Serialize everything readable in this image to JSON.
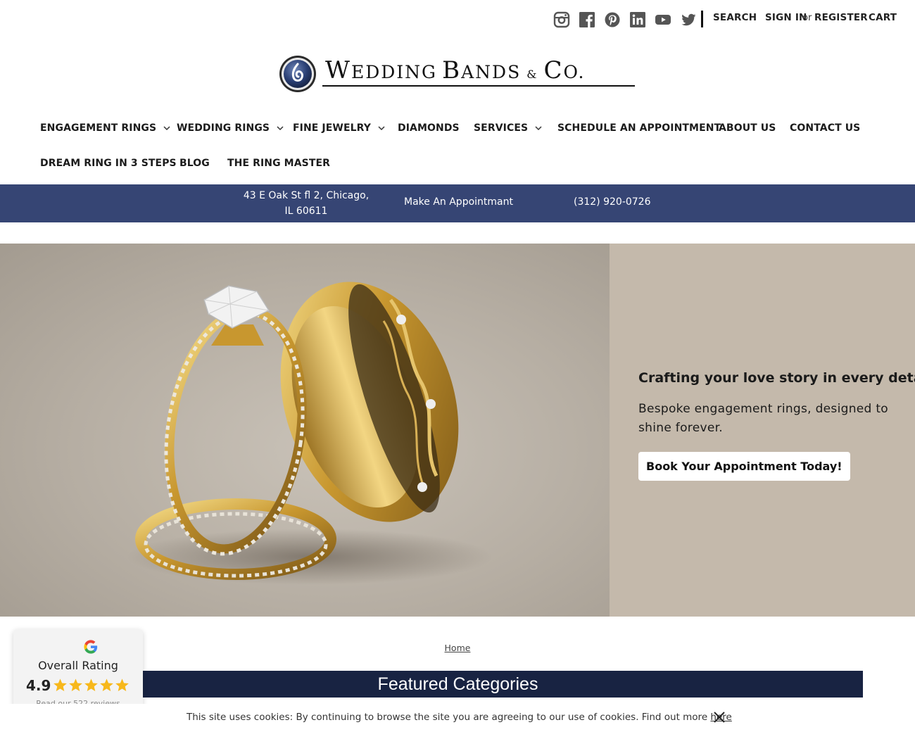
{
  "topbar": {
    "social_icons": [
      "instagram-icon",
      "facebook-icon",
      "pinterest-icon",
      "linkedin-icon",
      "youtube-icon",
      "twitter-icon"
    ],
    "search_label": "SEARCH",
    "signin_label": "SIGN IN",
    "or_label": "or",
    "register_label": "REGISTER",
    "cart_label": "CART"
  },
  "logo": {
    "w": "W",
    "edding": "EDDING",
    "b": "B",
    "ands": "ANDS",
    "amp": "&",
    "c": "C",
    "o": "O."
  },
  "nav": {
    "items": [
      {
        "label": "ENGAGEMENT RINGS",
        "has_dropdown": true
      },
      {
        "label": "WEDDING RINGS",
        "has_dropdown": true
      },
      {
        "label": "FINE JEWELRY",
        "has_dropdown": true
      },
      {
        "label": "DIAMONDS",
        "has_dropdown": false
      },
      {
        "label": "SERVICES",
        "has_dropdown": true
      },
      {
        "label": "SCHEDULE AN APPOINTMENT",
        "has_dropdown": false
      },
      {
        "label": "ABOUT US",
        "has_dropdown": false
      },
      {
        "label": "CONTACT US",
        "has_dropdown": false
      },
      {
        "label": "DREAM RING IN 3 STEPS",
        "has_dropdown": false
      },
      {
        "label": "BLOG",
        "has_dropdown": false
      },
      {
        "label": "THE RING MASTER",
        "has_dropdown": false
      }
    ]
  },
  "infobar": {
    "address": "43 E Oak St fl 2, Chicago, IL 60611",
    "appointment": "Make An Appointmant",
    "phone": "(312) 920-0726",
    "background": "#364574"
  },
  "hero": {
    "title": "Crafting your love story in every detail",
    "subtitle": "Bespoke engagement rings, designed to shine forever.",
    "button": "Book Your Appointment Today!",
    "panel_color": "#c4b9ab"
  },
  "breadcrumb": {
    "home": "Home"
  },
  "featured": {
    "title": "Featured Categories",
    "background": "#182342"
  },
  "rating": {
    "label": "Overall Rating",
    "score": "4.9",
    "stars": 5,
    "reviews_link": "Read our 522 reviews",
    "star_color": "#f7b81b"
  },
  "cookie": {
    "text": "This site uses cookies: By continuing to browse the site you are agreeing to our use of cookies. Find out more",
    "link": "here"
  }
}
